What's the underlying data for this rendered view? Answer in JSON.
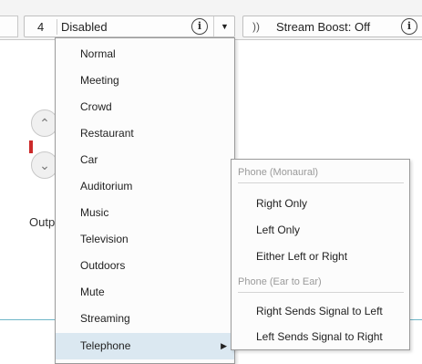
{
  "toolbar": {
    "program_number": "4",
    "program_name": "Disabled",
    "info_glyph": "i",
    "dropdown_icon": "triangle-down-icon",
    "boost_icon": "sound-wave-icon",
    "boost_label": "Stream Boost: Off"
  },
  "panel": {
    "output_label": "Outp"
  },
  "program_menu": {
    "items": [
      {
        "label": "Normal"
      },
      {
        "label": "Meeting"
      },
      {
        "label": "Crowd"
      },
      {
        "label": "Restaurant"
      },
      {
        "label": "Car"
      },
      {
        "label": "Auditorium"
      },
      {
        "label": "Music"
      },
      {
        "label": "Television"
      },
      {
        "label": "Outdoors"
      },
      {
        "label": "Mute"
      },
      {
        "label": "Streaming"
      },
      {
        "label": "Telephone",
        "selected": true,
        "has_submenu": true
      }
    ]
  },
  "telephone_submenu": {
    "monaural_header": "Phone (Monaural)",
    "monaural_options": [
      "Right Only",
      "Left Only",
      "Either Left or Right"
    ],
    "ear_to_ear_header": "Phone (Ear to Ear)",
    "ear_to_ear_options": [
      "Right Sends Signal to Left",
      "Left Sends Signal to Right"
    ]
  }
}
